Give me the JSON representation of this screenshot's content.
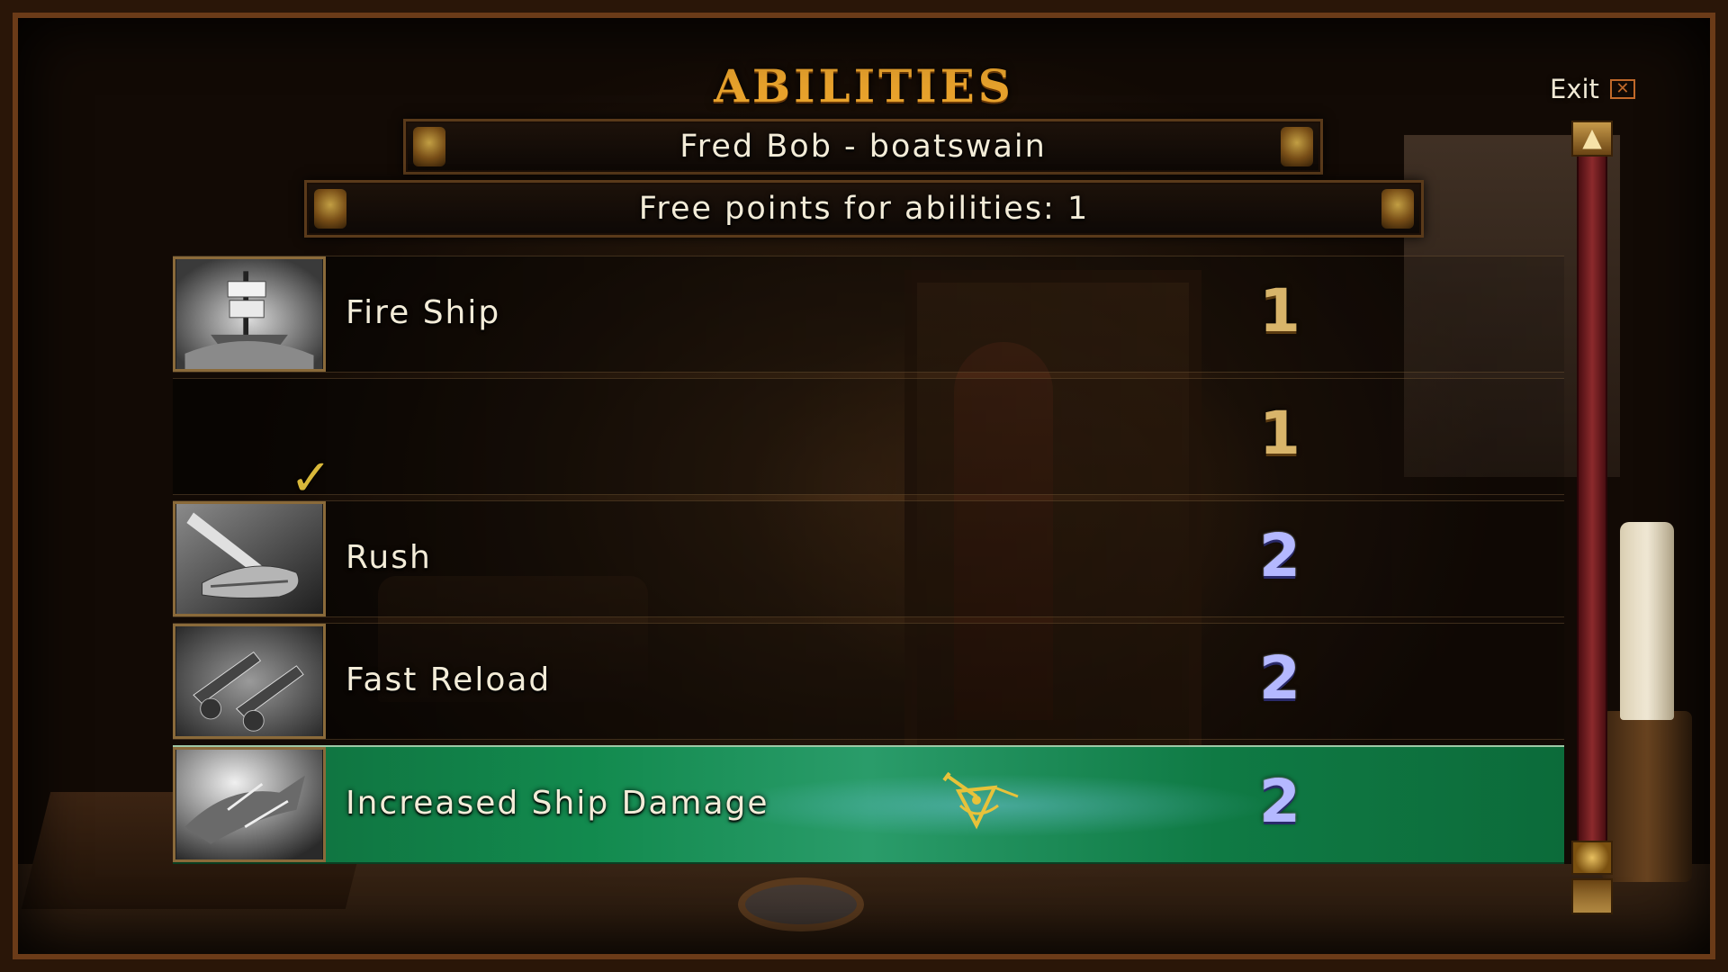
{
  "header": {
    "title": "ABILITIES",
    "exit_label": "Exit",
    "exit_icon": "close-x-icon"
  },
  "character": {
    "name_line": "Fred Bob - boatswain",
    "free_points_line": "Free points for abilities: 1"
  },
  "abilities": [
    {
      "name": "Fire Ship",
      "cost": "1",
      "icon": "fire-ship-icon",
      "selected": false
    },
    {
      "name": "",
      "cost": "1",
      "icon": "",
      "selected": false,
      "checked": true
    },
    {
      "name": "Rush",
      "cost": "2",
      "icon": "rush-icon",
      "selected": false
    },
    {
      "name": "Fast Reload",
      "cost": "2",
      "icon": "fast-reload-icon",
      "selected": false
    },
    {
      "name": "Increased Ship Damage",
      "cost": "2",
      "icon": "increased-ship-damage-icon",
      "selected": true
    }
  ],
  "colors": {
    "title": "#e8a22c",
    "selected_row": "#128a4e",
    "cost_1": "#d8b46a",
    "cost_2": "#b4b8ff",
    "check": "#d9b83a"
  }
}
